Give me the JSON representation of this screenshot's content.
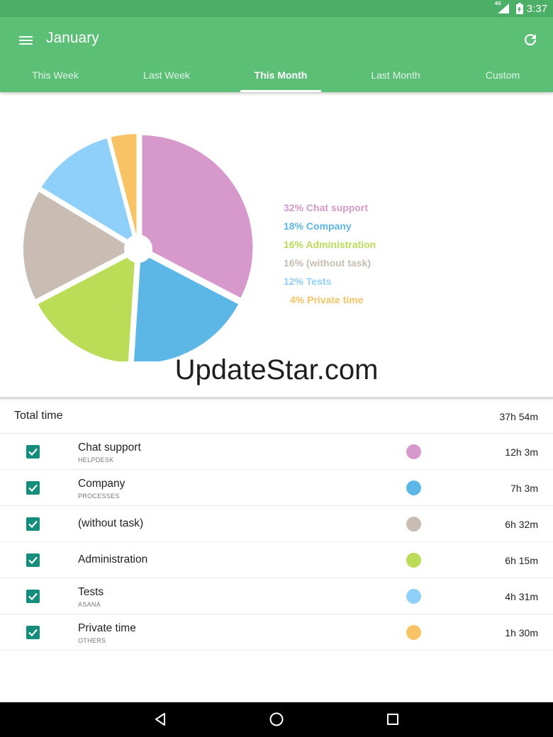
{
  "status_bar": {
    "time": "3:37",
    "network": "4G"
  },
  "toolbar": {
    "title": "January"
  },
  "tabs": [
    {
      "label": "This Week",
      "active": false
    },
    {
      "label": "Last Week",
      "active": false
    },
    {
      "label": "This Month",
      "active": true
    },
    {
      "label": "Last Month",
      "active": false
    },
    {
      "label": "Custom",
      "active": false
    }
  ],
  "chart_data": {
    "type": "pie",
    "slices": [
      {
        "label": "Chat support",
        "percent": 32,
        "legend": "32% Chat support",
        "color": "#d799cc"
      },
      {
        "label": "Company",
        "percent": 18,
        "legend": "18% Company",
        "color": "#5db7e6"
      },
      {
        "label": "Administration",
        "percent": 16,
        "legend": "16% Administration",
        "color": "#badc57"
      },
      {
        "label": "(without task)",
        "percent": 16,
        "legend": "16% (without task)",
        "color": "#c8bcb3"
      },
      {
        "label": "Tests",
        "percent": 12,
        "legend": "12% Tests",
        "color": "#8fd0fb"
      },
      {
        "label": "Private time",
        "percent": 4,
        "legend": "4% Private time",
        "color": "#f7c364"
      }
    ]
  },
  "watermark": "UpdateStar.com",
  "summary": {
    "label": "Total time",
    "value": "37h 54m"
  },
  "tasks": [
    {
      "name": "Chat support",
      "project": "HELPDESK",
      "color": "#d799cc",
      "time": "12h 3m",
      "checked": true
    },
    {
      "name": "Company",
      "project": "PROCESSES",
      "color": "#5db7e6",
      "time": "7h 3m",
      "checked": true
    },
    {
      "name": "(without task)",
      "project": "",
      "color": "#c8bcb3",
      "time": "6h 32m",
      "checked": true
    },
    {
      "name": "Administration",
      "project": "",
      "color": "#badc57",
      "time": "6h 15m",
      "checked": true
    },
    {
      "name": "Tests",
      "project": "ASANA",
      "color": "#8fd0fb",
      "time": "4h 31m",
      "checked": true
    },
    {
      "name": "Private time",
      "project": "OTHERS",
      "color": "#f7c364",
      "time": "1h 30m",
      "checked": true
    }
  ],
  "nav": {
    "icons": [
      "back-icon",
      "home-icon",
      "recents-icon"
    ]
  }
}
